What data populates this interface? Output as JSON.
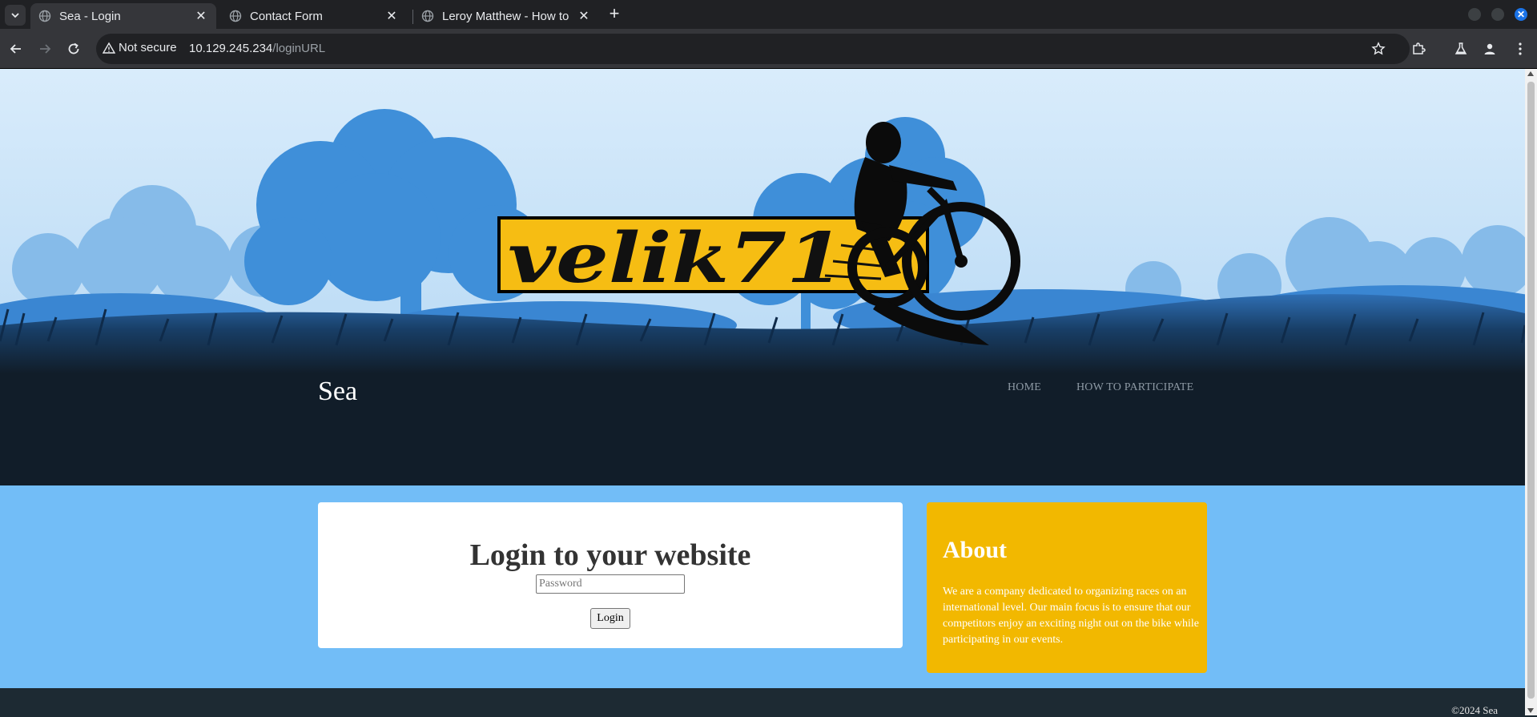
{
  "browser": {
    "tabs": [
      {
        "title": "Sea - Login",
        "active": true
      },
      {
        "title": "Contact Form",
        "active": false
      },
      {
        "title": "Leroy Matthew - How to",
        "active": false
      }
    ],
    "security_label": "Not secure",
    "url_host": "10.129.245.234",
    "url_path": "/loginURL"
  },
  "site": {
    "banner_logo_text": "velik71",
    "title": "Sea",
    "nav": [
      "HOME",
      "HOW TO PARTICIPATE"
    ]
  },
  "login": {
    "heading": "Login to your website",
    "password_placeholder": "Password",
    "button_label": "Login"
  },
  "about": {
    "heading": "About",
    "text": "We are a company dedicated to organizing races on an international level. Our main focus is to ensure that our competitors enjoy an exciting night out on the bike while participating in our events."
  },
  "footer": {
    "copyright": "©2024 Sea"
  },
  "colors": {
    "header_bg": "#111d29",
    "content_bg": "#72bdf7",
    "about_bg": "#f2b800",
    "footer_bg": "#1d2a33"
  }
}
